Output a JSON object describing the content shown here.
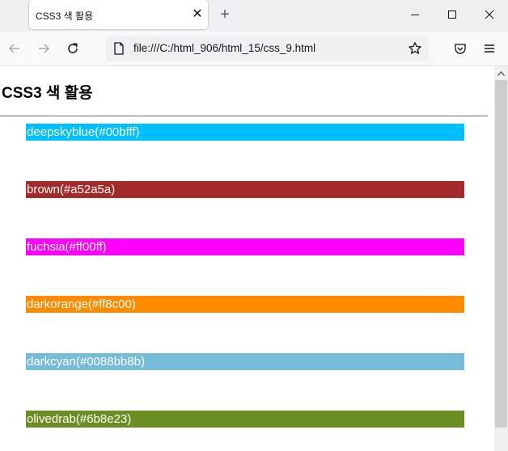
{
  "browser": {
    "tab_title": "CSS3 색 활용",
    "tab_close_glyph": "✕",
    "new_tab_glyph": "+",
    "url": "file:///C:/html_906/html_15/css_9.html"
  },
  "page": {
    "heading": "CSS3 색 활용",
    "items": [
      {
        "label": "deepskyblue(#00bfff)",
        "color": "#00bfff"
      },
      {
        "label": "brown(#a52a5a)",
        "color": "#a52a2a"
      },
      {
        "label": "fuchsia(#ff00ff)",
        "color": "#ff00ff"
      },
      {
        "label": "darkorange(#ff8c00)",
        "color": "#ff8c00"
      },
      {
        "label": "darkcyan(#0088bb8b)",
        "color": "#76bcd8"
      },
      {
        "label": "olivedrab(#6b8e23)",
        "color": "#6b8e23"
      }
    ]
  }
}
